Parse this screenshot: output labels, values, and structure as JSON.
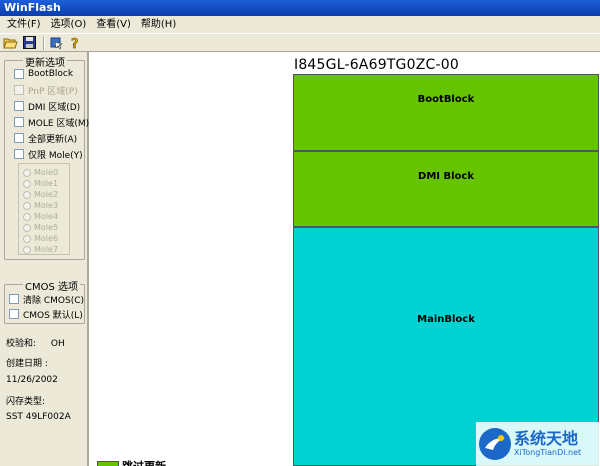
{
  "window": {
    "title": "WinFlash"
  },
  "menu": [
    "文件(F)",
    "选项(O)",
    "查看(V)",
    "帮助(H)"
  ],
  "toolbar": {
    "icons": [
      "open-folder-icon",
      "save-disk-icon",
      "flash-chip-icon",
      "help-icon"
    ]
  },
  "update_group": {
    "title": "更新选项",
    "options": [
      {
        "label": "BootBlock",
        "enabled": true
      },
      {
        "label": "PnP 区域(P)",
        "enabled": false
      },
      {
        "label": "DMI 区域(D)",
        "enabled": true
      },
      {
        "label": "MOLE 区域(M)",
        "enabled": true
      },
      {
        "label": "全部更新(A)",
        "enabled": true
      },
      {
        "label": "仅限 Mole(Y)",
        "enabled": true
      }
    ],
    "mole_options": [
      "Mole0",
      "Mole1",
      "Mole2",
      "Mole3",
      "Mole4",
      "Mole5",
      "Mole6",
      "Mole7"
    ]
  },
  "cmos_group": {
    "title": "CMOS 选项",
    "options": [
      {
        "label": "清除 CMOS(C)"
      },
      {
        "label": "CMOS 默认(L)"
      }
    ]
  },
  "info": {
    "checksum_label": "校验和:",
    "checksum_value": "OH",
    "date_label": "创建日期 :",
    "date_value": "11/26/2002",
    "flash_type_label": "闪存类型:",
    "flash_type_value": "SST 49LF002A"
  },
  "main": {
    "chip_title": "I845GL-6A69TG0ZC-00",
    "blocks": [
      {
        "label": "BootBlock",
        "color": "#66c300"
      },
      {
        "label": "DMI Block",
        "color": "#66c300"
      },
      {
        "label": "MainBlock",
        "color": "#00d2d2"
      }
    ],
    "legend": {
      "label": "跳过更新",
      "color": "#66c300"
    }
  },
  "watermark": {
    "cn": "系统天地",
    "en": "XiTongTianDi.net"
  }
}
